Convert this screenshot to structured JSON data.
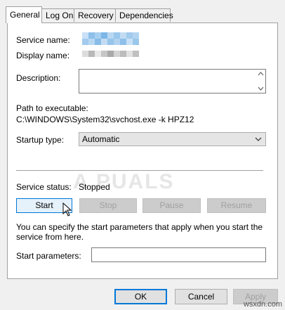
{
  "tabs": [
    {
      "label": "General",
      "active": true
    },
    {
      "label": "Log On",
      "active": false
    },
    {
      "label": "Recovery",
      "active": false
    },
    {
      "label": "Dependencies",
      "active": false
    }
  ],
  "general": {
    "service_name_label": "Service name:",
    "display_name_label": "Display name:",
    "description_label": "Description:",
    "path_label": "Path to executable:",
    "path_value": "C:\\WINDOWS\\System32\\svchost.exe -k HPZ12",
    "startup_type_label": "Startup type:",
    "startup_type_value": "Automatic",
    "service_status_label": "Service status:",
    "service_status_value": "Stopped",
    "start_button": "Start",
    "stop_button": "Stop",
    "pause_button": "Pause",
    "resume_button": "Resume",
    "help_text": "You can specify the start parameters that apply when you start the service from here.",
    "start_params_label": "Start parameters:",
    "start_params_value": ""
  },
  "dialog": {
    "ok_button": "OK",
    "cancel_button": "Cancel",
    "apply_button": "Apply"
  },
  "watermark": "A PUALS",
  "site_watermark": "wsxdn.com",
  "colors": {
    "accent": "#0078d7",
    "blur_light": "#b9d7f1",
    "blur_mid": "#8ec0ea",
    "disabled_text": "#a0a0a0"
  },
  "icons": {
    "dropdown": "chevron-down-icon",
    "cursor": "mouse-pointer-icon"
  }
}
